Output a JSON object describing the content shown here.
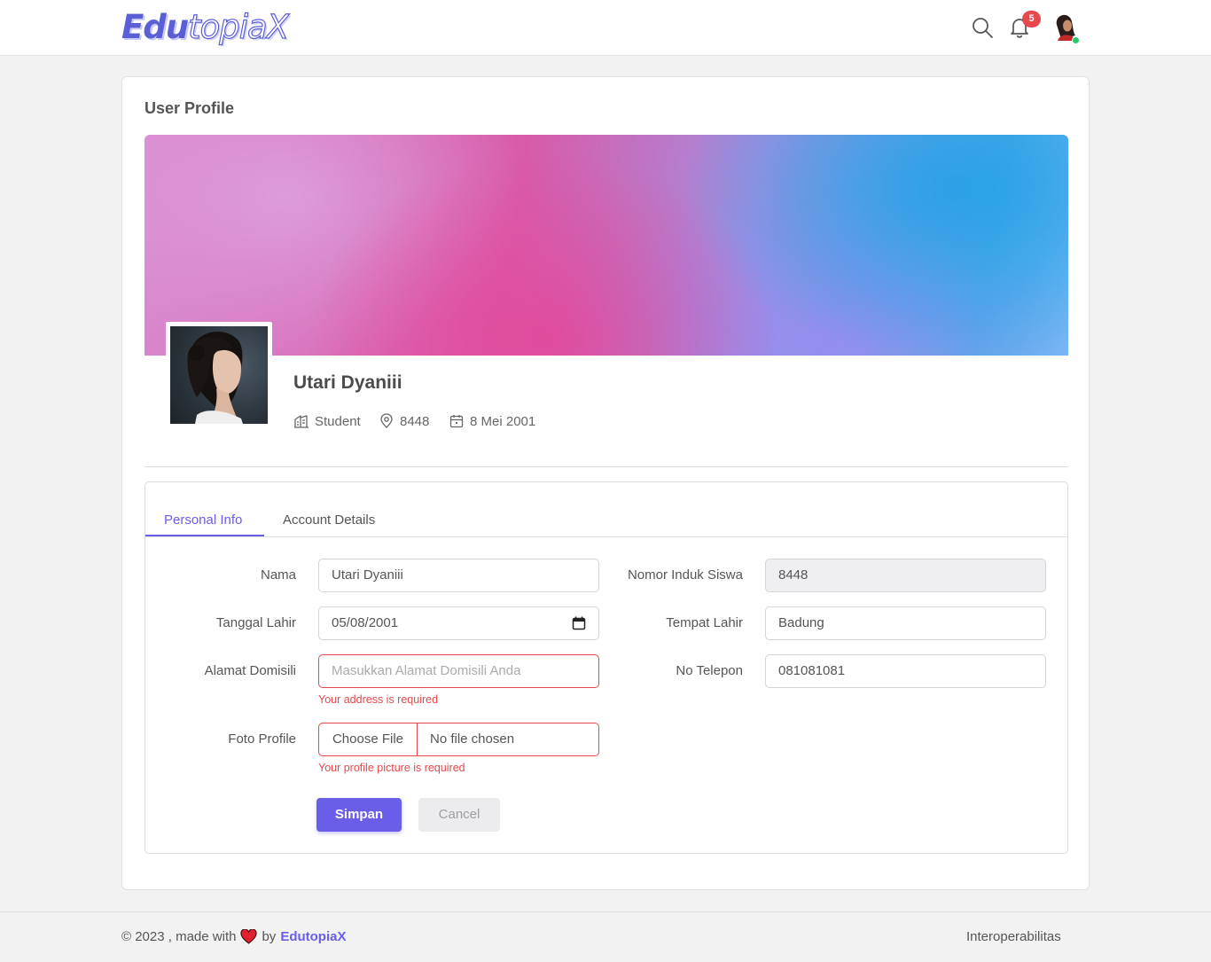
{
  "header": {
    "logo": {
      "part1": "Edu",
      "part2": "topia",
      "part3": "X"
    },
    "notification_count": "5"
  },
  "profile": {
    "page_title": "User Profile",
    "name": "Utari Dyaniii",
    "role": "Student",
    "location": "8448",
    "birth_date": "8 Mei 2001"
  },
  "tabs": [
    {
      "label": "Personal Info",
      "active": true
    },
    {
      "label": "Account Details",
      "active": false
    }
  ],
  "form": {
    "nama": {
      "label": "Nama",
      "value": "Utari Dyaniii"
    },
    "nis": {
      "label": "Nomor Induk Siswa",
      "value": "8448"
    },
    "tanggal_lahir": {
      "label": "Tanggal Lahir",
      "value": "05/08/2001"
    },
    "tempat_lahir": {
      "label": "Tempat Lahir",
      "value": "Badung"
    },
    "alamat": {
      "label": "Alamat Domisili",
      "placeholder": "Masukkan Alamat Domisili Anda",
      "error": "Your address is required"
    },
    "telepon": {
      "label": "No Telepon",
      "value": "081081081"
    },
    "foto": {
      "label": "Foto Profile",
      "button": "Choose File",
      "status": "No file chosen",
      "error": "Your profile picture is required"
    },
    "save_label": "Simpan",
    "cancel_label": "Cancel"
  },
  "footer": {
    "copyright": "© 2023 , made with",
    "by": "by",
    "brand": "EdutopiaX",
    "link": "Interoperabilitas"
  },
  "colors": {
    "accent": "#6a5de8",
    "error": "#e5484d",
    "online": "#28c76f"
  }
}
